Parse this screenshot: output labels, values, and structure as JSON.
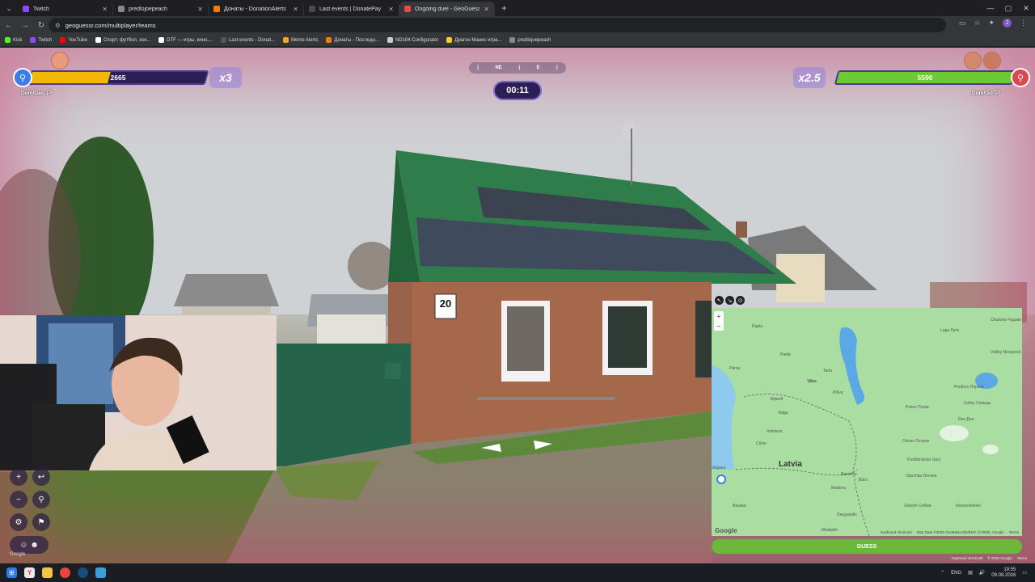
{
  "browser": {
    "tabs": [
      {
        "title": "Twitch",
        "color": "#9146ff",
        "active": false
      },
      {
        "title": "predlojoepeach",
        "color": "#888888",
        "active": false
      },
      {
        "title": "Донаты - DonationAlerts",
        "color": "#f57d07",
        "active": false
      },
      {
        "title": "Last events | DonatePay",
        "color": "#4a4a4a",
        "active": false
      },
      {
        "title": "Ongoing duel - GeoGuessr",
        "color": "#e64a4a",
        "active": true
      }
    ],
    "new_tab": "+",
    "url": "geoguessr.com/multiplayer/teams",
    "profile_initial": "J",
    "bookmarks": [
      {
        "label": "Kick",
        "color": "#53fc18"
      },
      {
        "label": "Twitch",
        "color": "#9146ff"
      },
      {
        "label": "YouTube",
        "color": "#ff0000"
      },
      {
        "label": "Спорт: футбол, хок...",
        "color": "#ffffff"
      },
      {
        "label": "DTF — игры, кино,...",
        "color": "#ffffff"
      },
      {
        "label": "Last events - Donat...",
        "color": "#555555"
      },
      {
        "label": "Meme Alerts",
        "color": "#f5a623"
      },
      {
        "label": "Донаты - Последн...",
        "color": "#f57d07"
      },
      {
        "label": "ND104 Configurator",
        "color": "#cccccc"
      },
      {
        "label": "Драгон Манис игра...",
        "color": "#f5d023"
      },
      {
        "label": "predlojoepeach",
        "color": "#888888"
      }
    ]
  },
  "hud": {
    "left_team": {
      "score": "2665",
      "multiplier": "x3",
      "player": "Dom/Geo",
      "fill_fraction": 0.45,
      "fill_color": "#f2b807"
    },
    "right_team": {
      "score": "5590",
      "multiplier": "x2.5",
      "player": "Dom/Gri",
      "fill_fraction": 1.0,
      "fill_color": "#6ccb2e"
    },
    "compass": {
      "labels": [
        "NE",
        "E"
      ]
    },
    "timer": "00:11"
  },
  "street": {
    "house_number": "20"
  },
  "map": {
    "country_label": "Latvia",
    "cities": [
      {
        "name": "Tartu"
      },
      {
        "name": "Pskov Псков"
      },
      {
        "name": "Velikiy Novgorod Великий Новгород"
      },
      {
        "name": "Valga"
      },
      {
        "name": "Rezekne"
      },
      {
        "name": "Daugavpils"
      },
      {
        "name": "Põlva"
      },
      {
        "name": "Võru"
      },
      {
        "name": "Ostrov Остров"
      },
      {
        "name": "Porkhov Порхов"
      },
      {
        "name": "Soltsy Сольцы"
      },
      {
        "name": "Dno Дно"
      },
      {
        "name": "Pushkinskiye Gory"
      },
      {
        "name": "Opochka Опочка"
      },
      {
        "name": "Sebezh Себеж"
      },
      {
        "name": "Novosokolniki"
      },
      {
        "name": "Jelgava"
      },
      {
        "name": "Madona"
      },
      {
        "name": "Balvi"
      },
      {
        "name": "Rapla"
      },
      {
        "name": "Paide"
      },
      {
        "name": "Pärnu"
      },
      {
        "name": "Viljandi"
      },
      {
        "name": "Cēsis"
      },
      {
        "name": "Valmiera"
      },
      {
        "name": "Jēkabpils"
      },
      {
        "name": "Bauska"
      },
      {
        "name": "Luga Луга"
      },
      {
        "name": "Chudovo Чудово"
      },
      {
        "name": "Elva"
      }
    ],
    "footer_shortcuts": "Keyboard shortcuts",
    "footer_data": "Map Data ©2026 GeoBasis-DE/BKG (©2009), Google",
    "footer_terms": "Terms",
    "google": "Google"
  },
  "guess_button": "GUESS",
  "bottom_note": {
    "shortcuts": "Keyboard shortcuts",
    "data": "© 2026 Google",
    "terms": "Terms"
  },
  "taskbar": {
    "lang": "ENG",
    "time": "19:55",
    "date": "09.08.2026"
  }
}
